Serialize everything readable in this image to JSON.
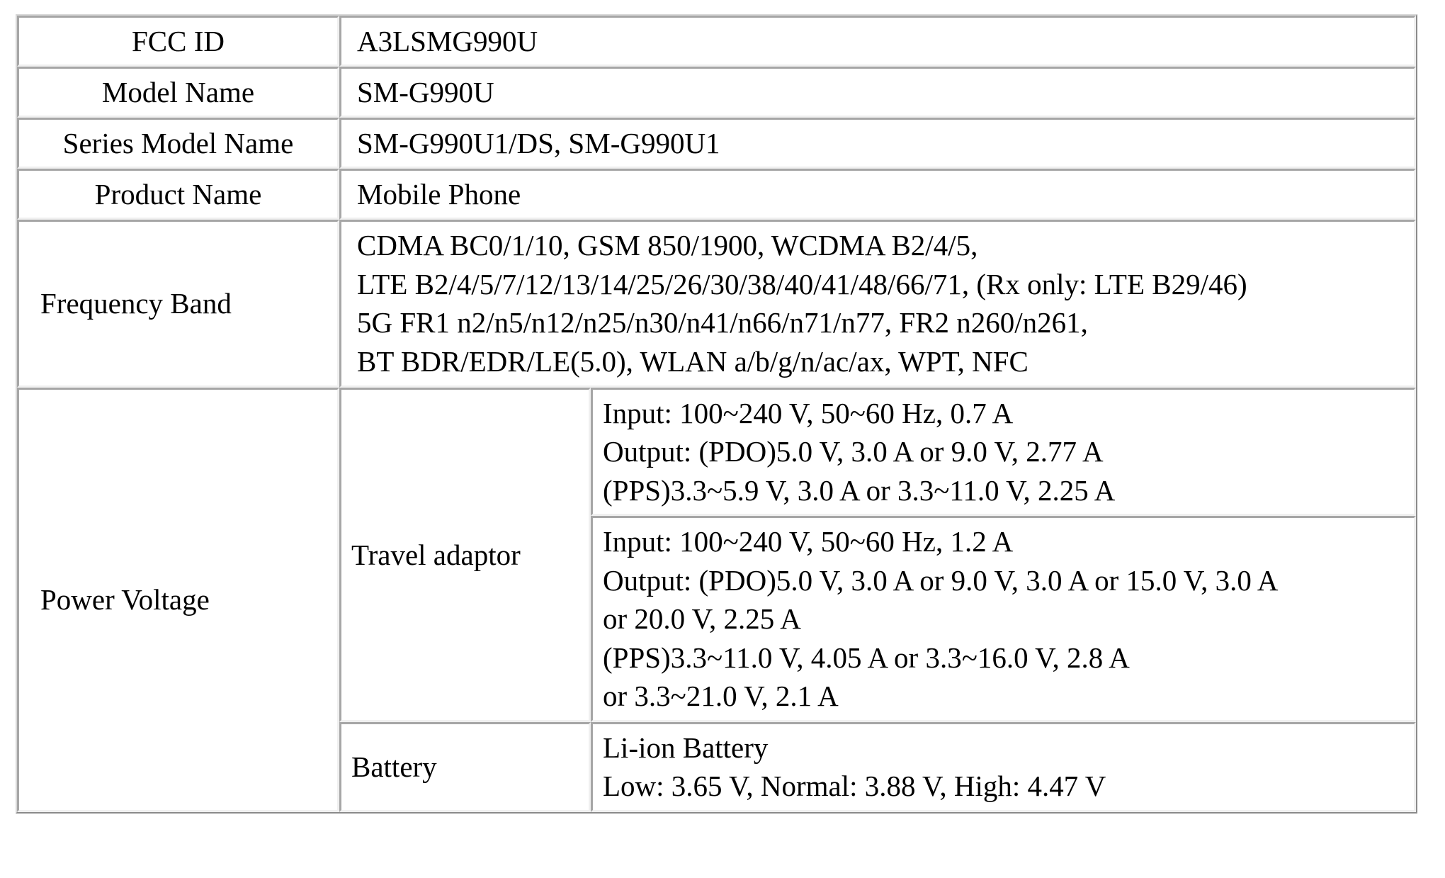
{
  "document": {
    "type": "fcc-equipment-specification-table"
  },
  "table": {
    "rows": [
      {
        "label": "FCC ID",
        "value": "A3LSMG990U"
      },
      {
        "label": "Model Name",
        "value": "SM-G990U"
      },
      {
        "label": "Series Model Name",
        "value": "SM-G990U1/DS, SM-G990U1"
      },
      {
        "label": "Product Name",
        "value": "Mobile Phone"
      }
    ],
    "frequency_band": {
      "label": "Frequency Band",
      "lines": [
        "CDMA BC0/1/10, GSM 850/1900, WCDMA B2/4/5,",
        "LTE B2/4/5/7/12/13/14/25/26/30/38/40/41/48/66/71, (Rx only: LTE B29/46)",
        "5G FR1 n2/n5/n12/n25/n30/n41/n66/n71/n77, FR2 n260/n261,",
        "BT BDR/EDR/LE(5.0), WLAN a/b/g/n/ac/ax, WPT, NFC"
      ]
    },
    "power_voltage": {
      "label": "Power Voltage",
      "travel_adaptor": {
        "label": "Travel adaptor",
        "blocks": [
          {
            "lines": [
              "Input:  100~240 V, 50~60  Hz, 0.7 A",
              "Output: (PDO)5.0 V, 3.0 A or 9.0 V, 2.77 A",
              "(PPS)3.3~5.9 V, 3.0 A or 3.3~11.0 V, 2.25 A"
            ]
          },
          {
            "lines": [
              "Input:  100~240 V, 50~60  Hz, 1.2 A",
              "Output: (PDO)5.0 V, 3.0 A or 9.0 V, 3.0 A or 15.0 V, 3.0 A",
              "or 20.0 V, 2.25 A",
              "(PPS)3.3~11.0 V, 4.05 A or 3.3~16.0 V, 2.8 A",
              "or 3.3~21.0 V, 2.1 A"
            ]
          }
        ]
      },
      "battery": {
        "label": "Battery",
        "lines": [
          "Li-ion Battery",
          "Low: 3.65 V, Normal: 3.88 V, High: 4.47 V"
        ]
      }
    }
  },
  "colors": {
    "text": "#000000",
    "background": "#ffffff",
    "border_dark": "#a6a6a6",
    "border_light": "#f0f0f0",
    "frame": "#8a8a8a"
  }
}
